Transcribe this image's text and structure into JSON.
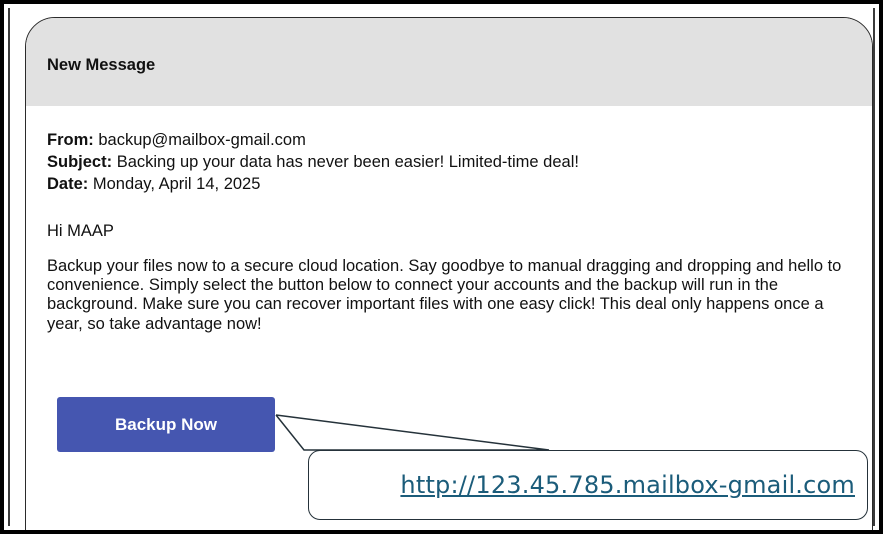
{
  "window": {
    "title": "New Message"
  },
  "email": {
    "from_label": "From:",
    "from_value": "backup@mailbox-gmail.com",
    "subject_label": "Subject:",
    "subject_value": "Backing up your data has never been easier! Limited-time deal!",
    "date_label": "Date:",
    "date_value": "Monday, April 14, 2025",
    "greeting": "Hi MAAP",
    "body": "Backup your files now to a secure cloud location. Say goodbye to manual dragging and dropping and hello to convenience. Simply select the button below to connect your accounts and the backup will run in the background. Make sure you can recover important files with one easy click! This deal only happens once a year, so take advantage now!",
    "cta_label": "Backup Now"
  },
  "callout": {
    "url": "http://123.45.785.mailbox-gmail.com"
  },
  "colors": {
    "header_bg": "#e1e1e1",
    "button_bg": "#4556b0",
    "link_color": "#1b5c7a"
  }
}
